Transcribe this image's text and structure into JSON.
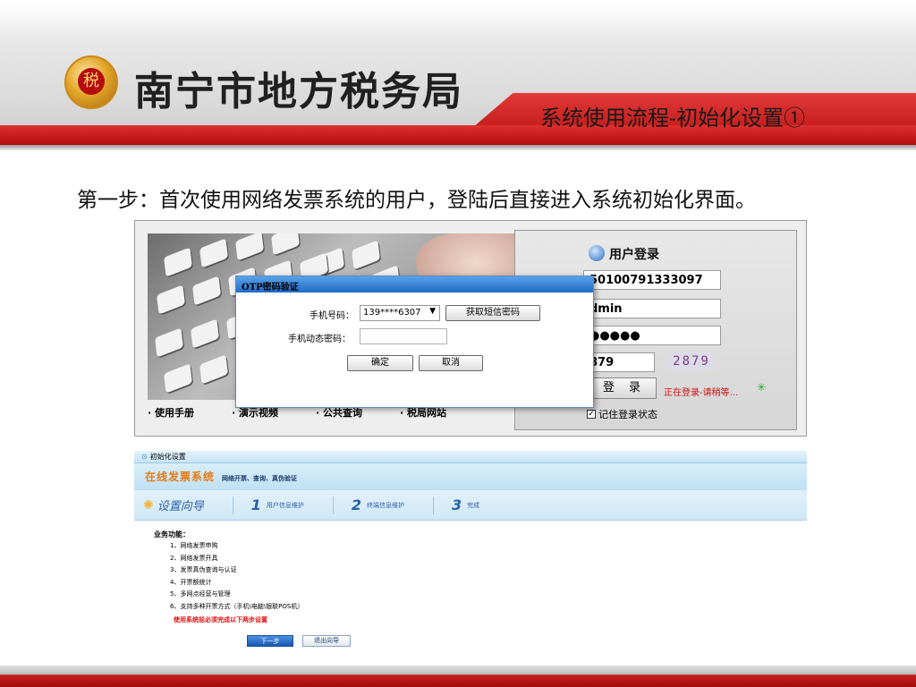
{
  "header": {
    "org_name": "南宁市地方税务局",
    "section_title": "系统使用流程-初始化设置①"
  },
  "step_text": "第一步：首次使用网络发票系统的用户，登陆后直接进入系统初始化界面。",
  "login_screenshot": {
    "links": [
      "· 使用手册",
      "· 演示视频",
      "· 公共查询",
      "· 税局网站"
    ],
    "login_panel": {
      "title": "用户登录",
      "account_value": "50100791333097",
      "username_value": "dmin",
      "password_value": "●●●●●",
      "captcha_input_value": "879",
      "captcha_image_text": "2879",
      "login_button_label": "登 录",
      "status_text": "正在登录-请稍等...",
      "remember_label": "记住登录状态",
      "remember_checked": true
    },
    "otp_dialog": {
      "title": "OTP密码验证",
      "phone_label": "手机号码：",
      "phone_value": "139****6307",
      "get_sms_button": "获取短信密码",
      "code_label": "手机动态密码：",
      "code_value": "",
      "confirm_button": "确定",
      "cancel_button": "取消"
    }
  },
  "init_screenshot": {
    "window_title": "初始化设置",
    "system_name": "在线发票系统",
    "system_subtitle": "网络开票、查询、真伪验证",
    "wizard_label": "设置向导",
    "steps": [
      {
        "num": "1",
        "label": "用户信息维护"
      },
      {
        "num": "2",
        "label": "终端信息维护"
      },
      {
        "num": "3",
        "label": "完成"
      }
    ],
    "business_title": "业务功能：",
    "business_items": [
      "1、网络发票申购",
      "2、网络发票开具",
      "3、发票真伪查询与认证",
      "4、开票额统计",
      "5、多网点经营与管理",
      "6、支持多种开票方式（手机\\电脑\\银联POS机）"
    ],
    "notice": "使用系统前必须完成以下两步设置",
    "next_button": "下一步",
    "exit_button": "退出向导"
  },
  "colors": {
    "brand_red": "#b30d0d",
    "accent_blue": "#2a5fa8",
    "system_orange": "#e87a10",
    "warning_red": "#e01010"
  }
}
